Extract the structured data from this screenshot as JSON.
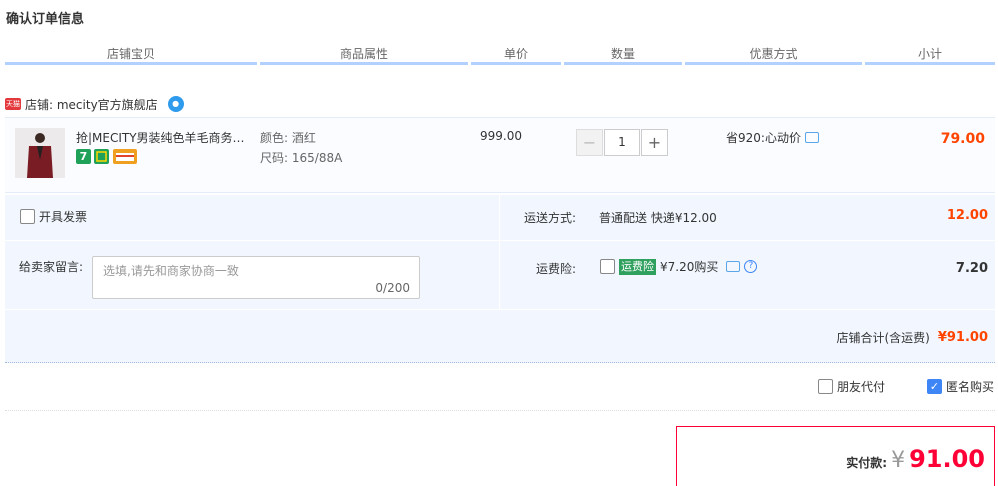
{
  "page_title": "确认订单信息",
  "columns": [
    "店铺宝贝",
    "商品属性",
    "单价",
    "数量",
    "优惠方式",
    "小计"
  ],
  "shop": {
    "badge": "天猫",
    "label": "店铺: mecity官方旗舰店"
  },
  "item": {
    "title": "抢|MECITY男装纯色羊毛商务…",
    "attr_color_label": "颜色:",
    "attr_color_value": "酒红",
    "attr_size_label": "尺码:",
    "attr_size_value": "165/88A",
    "price": "999.00",
    "qty_minus": "−",
    "qty": "1",
    "qty_plus": "+",
    "promo": "省920:心动价",
    "subtotal": "79.00"
  },
  "invoice": {
    "label": "开具发票"
  },
  "shipping": {
    "label": "运送方式:",
    "method": "普通配送 快递¥12.00",
    "amount": "12.00"
  },
  "message": {
    "label": "给卖家留言:",
    "placeholder": "选填,请先和商家协商一致",
    "count": "0/200"
  },
  "insurance": {
    "label": "运费险:",
    "tag": "运费险",
    "text": "¥7.20购买",
    "amount": "7.20"
  },
  "shop_total": {
    "label": "店铺合计(含运费)",
    "amount": "¥91.00"
  },
  "options": {
    "friend_pay": "朋友代付",
    "anonymous": "匿名购买"
  },
  "payment": {
    "label": "实付款:",
    "currency": "¥",
    "amount": "91.00"
  },
  "colors": {
    "accent_red": "#ff0036",
    "price_red": "#ff4400",
    "header_bar": "#b2d1ff",
    "panel_bg": "#f2f7ff",
    "checkbox_blue": "#3e86f5",
    "insurance_green": "#30a05f"
  }
}
